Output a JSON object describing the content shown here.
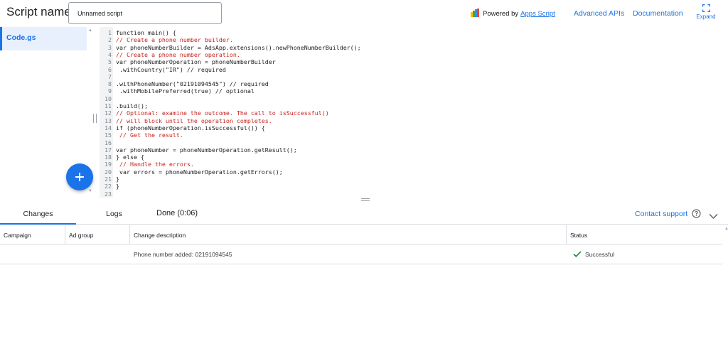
{
  "header": {
    "script_name_label": "Script name:",
    "script_name_value": "Unnamed script",
    "powered_by": "Powered by",
    "apps_script_link": "Apps Script",
    "advanced_apis": "Advanced APIs",
    "documentation": "Documentation",
    "expand": "Expand"
  },
  "files": [
    {
      "name": "Code.gs"
    }
  ],
  "editor": {
    "lines": [
      {
        "n": "1",
        "text": "function main() {",
        "kind": "code"
      },
      {
        "n": "2",
        "text": "// Create a phone number builder.",
        "kind": "comment"
      },
      {
        "n": "3",
        "text": "var phoneNumberBuilder = AdsApp.extensions().newPhoneNumberBuilder();",
        "kind": "code"
      },
      {
        "n": "4",
        "text": "// Create a phone number operation.",
        "kind": "comment"
      },
      {
        "n": "5",
        "text": "var phoneNumberOperation = phoneNumberBuilder",
        "kind": "code"
      },
      {
        "n": "6",
        "text": " .withCountry(\"IR\") // required",
        "kind": "code"
      },
      {
        "n": "7",
        "text": "",
        "kind": "code"
      },
      {
        "n": "8",
        "text": ".withPhoneNumber(\"02191094545\") // required",
        "kind": "code"
      },
      {
        "n": "9",
        "text": " .withMobilePreferred(true) // optional",
        "kind": "code"
      },
      {
        "n": "10",
        "text": "",
        "kind": "code"
      },
      {
        "n": "11",
        "text": ".build();",
        "kind": "code"
      },
      {
        "n": "12",
        "text": "// Optional: examine the outcome. The call to isSuccessful()",
        "kind": "comment"
      },
      {
        "n": "13",
        "text": "// will block until the operation completes.",
        "kind": "comment"
      },
      {
        "n": "14",
        "text": "if (phoneNumberOperation.isSuccessful()) {",
        "kind": "code"
      },
      {
        "n": "15",
        "text": " // Get the result.",
        "kind": "comment"
      },
      {
        "n": "16",
        "text": "",
        "kind": "code"
      },
      {
        "n": "17",
        "text": "var phoneNumber = phoneNumberOperation.getResult();",
        "kind": "code"
      },
      {
        "n": "18",
        "text": "} else {",
        "kind": "code"
      },
      {
        "n": "19",
        "text": " // Handle the errors.",
        "kind": "comment"
      },
      {
        "n": "20",
        "text": " var errors = phoneNumberOperation.getErrors();",
        "kind": "code"
      },
      {
        "n": "21",
        "text": "}",
        "kind": "code"
      },
      {
        "n": "22",
        "text": "}",
        "kind": "code"
      },
      {
        "n": "23",
        "text": "",
        "kind": "code"
      }
    ]
  },
  "bottom": {
    "tabs": [
      "Changes",
      "Logs"
    ],
    "done_status": "Done (0:06)",
    "contact_support": "Contact support"
  },
  "table": {
    "headers": [
      "Campaign",
      "Ad group",
      "Change description",
      "Status"
    ],
    "rows": [
      {
        "campaign": "",
        "ad_group": "",
        "description": "Phone number added: 02191094545",
        "status": "Successful"
      }
    ]
  },
  "colors": {
    "accent": "#1a73e8",
    "comment": "#c5221f",
    "success": "#188038"
  },
  "icons": {
    "apps_script_logo": "apps-script-logo-icon",
    "expand": "expand-icon",
    "add": "add-icon",
    "help": "help-icon",
    "collapse": "chevron-down-icon",
    "success": "check-icon"
  }
}
